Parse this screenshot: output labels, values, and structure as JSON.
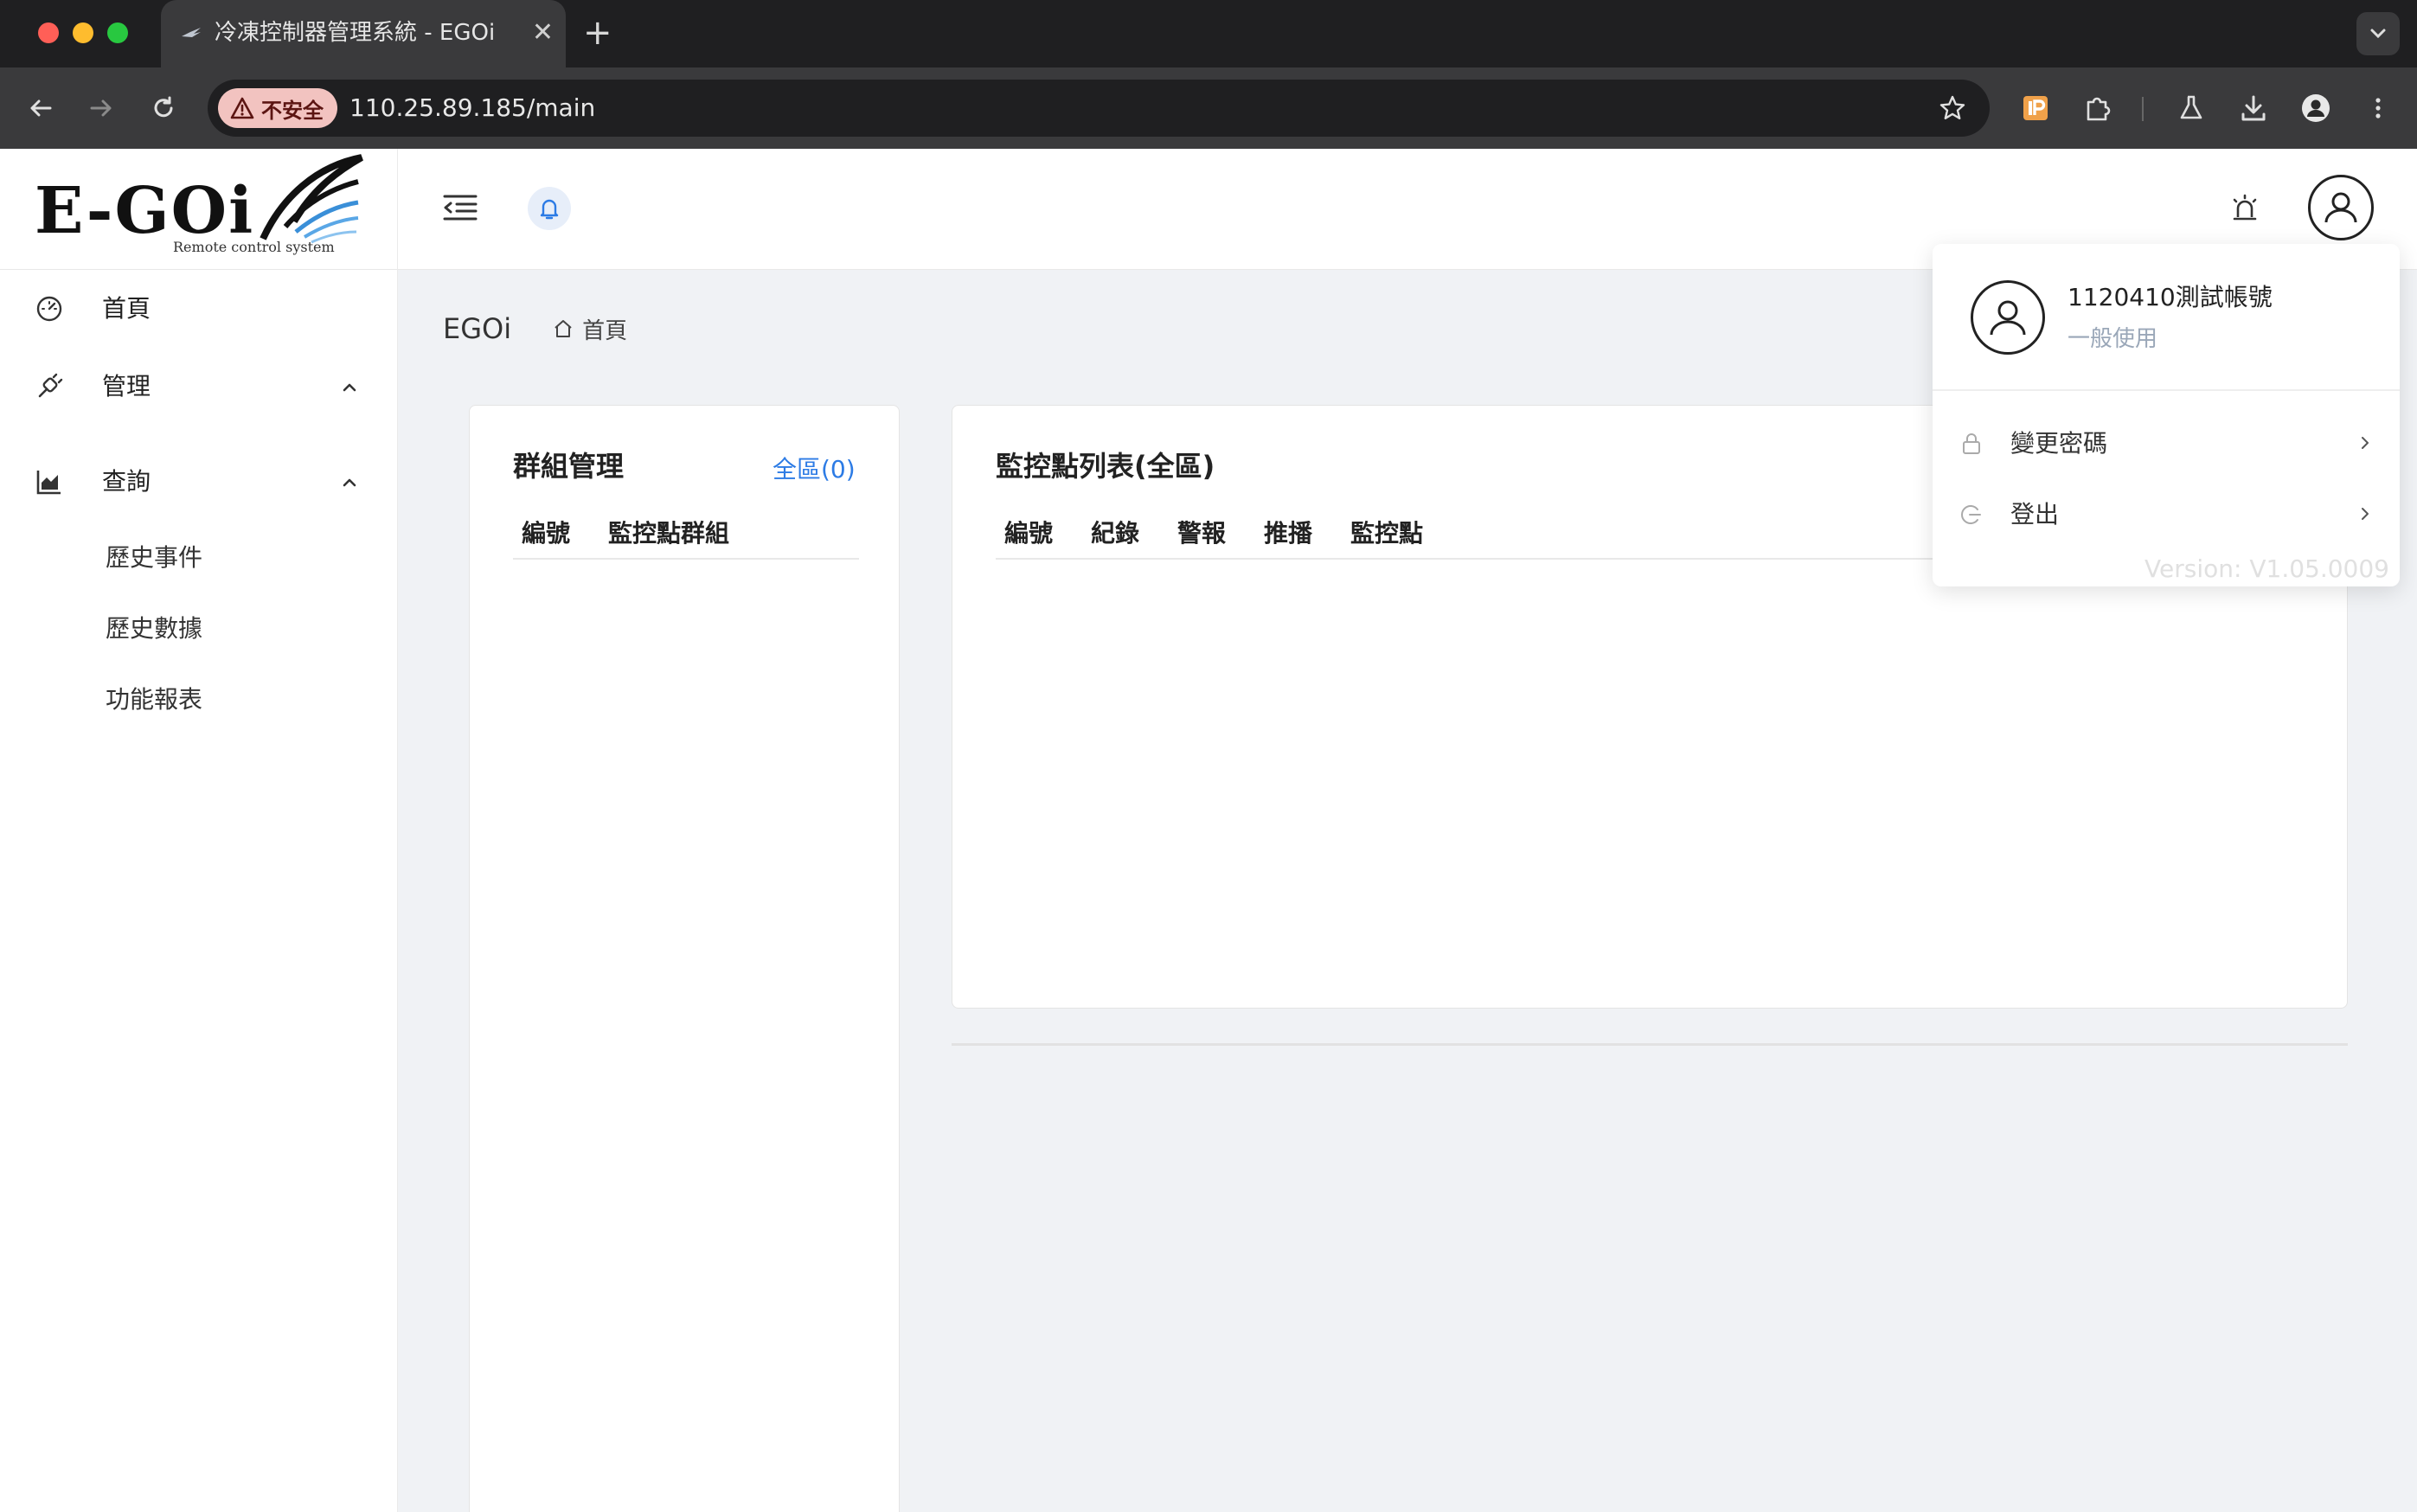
{
  "browser": {
    "tab_title": "冷凍控制器管理系統 - EGOi",
    "security_label": "不安全",
    "url": "110.25.89.185/main",
    "traffic_colors": [
      "#ff5f57",
      "#febc2e",
      "#28c840"
    ]
  },
  "header": {
    "logo_text": "E-GOi",
    "logo_subtitle": "Remote control system"
  },
  "sidebar": {
    "items": [
      {
        "label": "首頁",
        "icon": "dashboard-icon"
      },
      {
        "label": "管理",
        "icon": "plug-icon"
      },
      {
        "label": "查詢",
        "icon": "chart-icon"
      }
    ],
    "sub_items": [
      "歷史事件",
      "歷史數據",
      "功能報表"
    ]
  },
  "breadcrumb": {
    "title": "EGOi",
    "home": "首頁"
  },
  "group_card": {
    "title": "群組管理",
    "link": "全區(0)",
    "columns": [
      "編號",
      "監控點群組"
    ]
  },
  "monitor_card": {
    "title": "監控點列表(全區)",
    "columns": [
      "編號",
      "紀錄",
      "警報",
      "推播",
      "監控點"
    ]
  },
  "user_menu": {
    "name": "1120410測試帳號",
    "role": "一般使用",
    "items": [
      "變更密碼",
      "登出"
    ],
    "version": "Version: V1.05.0009"
  },
  "colors": {
    "accent": "#2c7be5",
    "security_chip": "#f2c3c0",
    "role_text": "#9aa7b8"
  }
}
